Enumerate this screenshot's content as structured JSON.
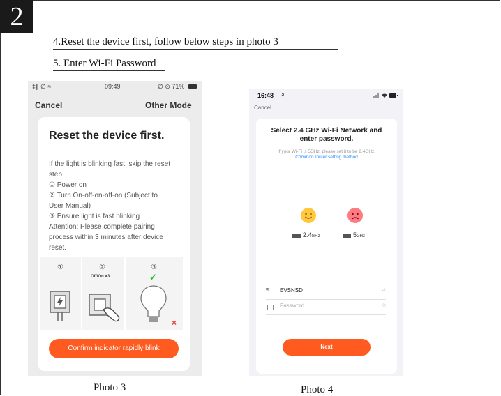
{
  "step": {
    "number": "2"
  },
  "instructions": {
    "step4": "4.Reset the device first, follow below steps in photo 3",
    "step5": "5. Enter Wi-Fi Password"
  },
  "photo3": {
    "caption": "Photo 3",
    "status": {
      "signal": "‡∥ ∅ ≈",
      "time": "09:49",
      "battery": "∅ ⊙ 71%"
    },
    "topbar": {
      "cancel": "Cancel",
      "other_mode": "Other Mode"
    },
    "card": {
      "title": "Reset the device first.",
      "lines": [
        "If the light is blinking fast, skip the reset",
        "step",
        "①  Power on",
        "②  Turn On-off-on-off-on (Subject to",
        "User Manual)",
        "③  Ensure light is fast blinking",
        "Attention: Please complete pairing",
        "process within 3 minutes after device",
        "reset."
      ],
      "illustration": {
        "step_numbers": [
          "①",
          "②",
          "③"
        ],
        "switch_label": "Off/On ×3",
        "check": "✓",
        "cross": "×"
      },
      "confirm_button": "Confirm indicator rapidly blink"
    }
  },
  "photo4": {
    "caption": "Photo 4",
    "status": {
      "time": "16:48",
      "location_arrow": "↗"
    },
    "topbar": {
      "cancel": "Cancel"
    },
    "card": {
      "title_line1": "Select 2.4 GHz Wi-Fi Network and",
      "title_line2": "enter password.",
      "note": "If your Wi-Fi is 5GHz, please set it to be 2.4GHz.",
      "link": "Common router setting method",
      "band_good": {
        "value": "2.4",
        "unit": "GHz"
      },
      "band_bad": {
        "value": "5",
        "unit": "GHz"
      },
      "ssid": "EVSNSD",
      "password_placeholder": "Password",
      "next_button": "Next"
    }
  }
}
